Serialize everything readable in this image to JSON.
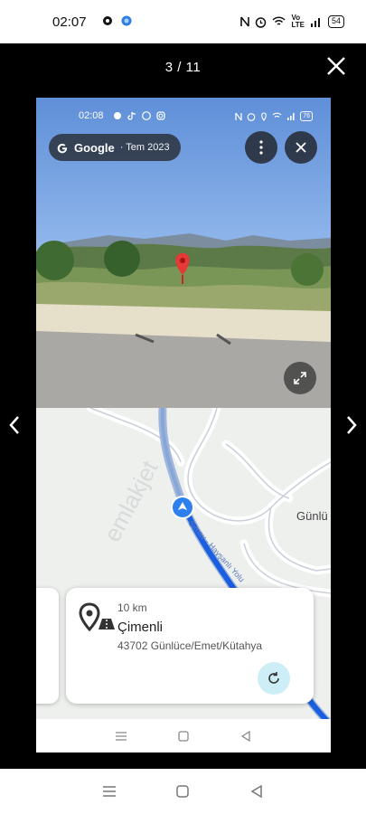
{
  "status_bar": {
    "time": "02:07",
    "battery": "54"
  },
  "viewer": {
    "counter": "3 / 11"
  },
  "inner_status": {
    "time": "02:08",
    "battery": "76"
  },
  "street_view": {
    "brand": "Google",
    "date": "· Tem 2023"
  },
  "map": {
    "label_gunluce": "Günlü",
    "road_label": "Simav - Hayşanlı Yolu",
    "watermark": "emlakjet"
  },
  "place_card": {
    "distance": "10 km",
    "name": "Çimenli",
    "address": "43702 Günlüce/Emet/Kütahya"
  },
  "icons": [
    "settings-icon",
    "app-icon",
    "mute-icon",
    "alarm-icon",
    "wifi-icon",
    "signal-icon",
    "close-icon",
    "chevron-left-icon",
    "chevron-right-icon",
    "google-g-icon",
    "more-vert-icon",
    "expand-icon",
    "map-pin-icon",
    "location-arrow-icon",
    "refresh-icon",
    "home-icon",
    "back-icon",
    "recents-icon"
  ],
  "colors": {
    "route_blue": "#1a5fe0",
    "pin_red": "#e53935",
    "card_accent": "#cdeef7"
  }
}
